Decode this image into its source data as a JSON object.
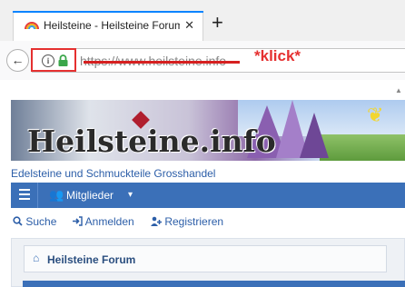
{
  "browser": {
    "tab_title": "Heilsteine - Heilsteine Forum",
    "tab_close": "✕",
    "new_tab": "+",
    "url": "https://www.heilsteine.info",
    "back": "←"
  },
  "annotation": {
    "text": "*klick*",
    "color": "#e53030"
  },
  "site": {
    "logo_text": "Heilsteine.info",
    "tagline": "Edelsteine und Schmuckteile Grosshandel",
    "nav": {
      "members": "Mitglieder",
      "chevron": "▾"
    },
    "user_links": [
      {
        "icon": "search-icon",
        "label": "Suche"
      },
      {
        "icon": "sign-in-icon",
        "label": "Anmelden"
      },
      {
        "icon": "user-plus-icon",
        "label": "Registrieren"
      }
    ],
    "breadcrumb": "Heilsteine Forum",
    "accent": "#3b70b8"
  }
}
